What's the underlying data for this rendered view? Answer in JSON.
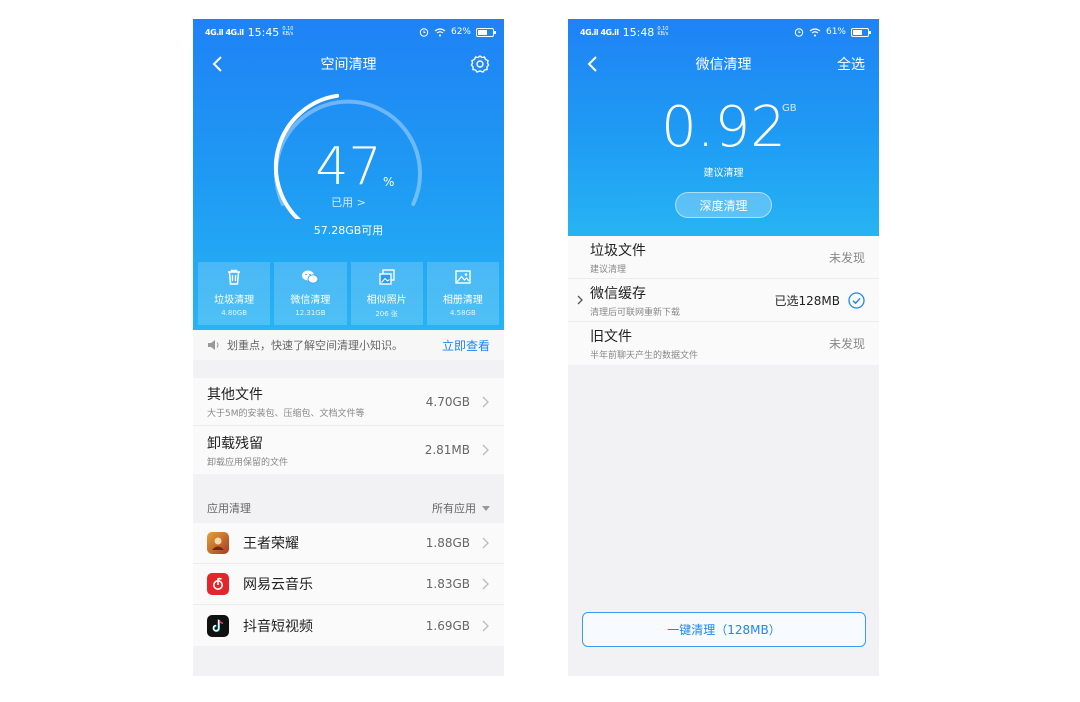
{
  "left_screen": {
    "status": {
      "signal": "4G.il 4G.il",
      "time": "15:45",
      "speed": "0.10 KB/s",
      "battery": "62%"
    },
    "nav": {
      "title": "空间清理"
    },
    "gauge": {
      "percent": "47",
      "percent_unit": "%",
      "used_label": "已用 >",
      "free": "57.28GB可用",
      "used_fraction": 0.47
    },
    "tiles": [
      {
        "label": "垃圾清理",
        "size": "4.80GB",
        "icon": "trash-icon"
      },
      {
        "label": "微信清理",
        "size": "12.31GB",
        "icon": "wechat-icon"
      },
      {
        "label": "相似照片",
        "size": "206 张",
        "icon": "photos-icon"
      },
      {
        "label": "相册清理",
        "size": "4.58GB",
        "icon": "album-icon"
      }
    ],
    "tip": {
      "text": "划重点，快速了解空间清理小知识。",
      "link": "立即查看"
    },
    "files": [
      {
        "title": "其他文件",
        "sub": "大于5M的安装包、压缩包、文档文件等",
        "value": "4.70GB"
      },
      {
        "title": "卸载残留",
        "sub": "卸载应用保留的文件",
        "value": "2.81MB"
      }
    ],
    "app_section": {
      "title": "应用清理",
      "filter": "所有应用"
    },
    "apps": [
      {
        "name": "王者荣耀",
        "size": "1.88GB",
        "color": "#c8452b"
      },
      {
        "name": "网易云音乐",
        "size": "1.83GB",
        "color": "#e2262b"
      },
      {
        "name": "抖音短视频",
        "size": "1.69GB",
        "color": "#111111"
      }
    ]
  },
  "right_screen": {
    "status": {
      "signal": "4G.il 4G.il",
      "time": "15:48",
      "speed": "0.10 KB/s",
      "battery": "61%"
    },
    "nav": {
      "title": "微信清理",
      "action": "全选"
    },
    "summary": {
      "value": "0.92",
      "unit": "GB",
      "hint": "建议清理",
      "deep_button": "深度清理"
    },
    "items": [
      {
        "title": "垃圾文件",
        "sub": "建议清理",
        "value": "未发现",
        "selected": false
      },
      {
        "title": "微信缓存",
        "sub": "清理后可联网重新下载",
        "value": "已选128MB",
        "selected": true
      },
      {
        "title": "旧文件",
        "sub": "半年前聊天产生的数据文件",
        "value": "未发现",
        "selected": false
      }
    ],
    "clean_button": "一键清理（128MB）"
  },
  "colors": {
    "accent": "#1f86f5",
    "header_top": "#1f82f5",
    "header_bottom": "#27b4f3"
  }
}
